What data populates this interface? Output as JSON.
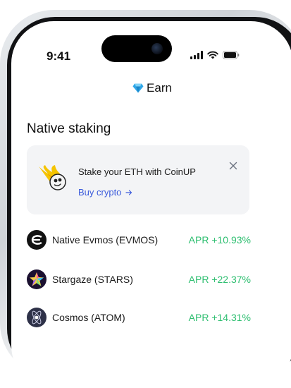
{
  "status_bar": {
    "time": "9:41"
  },
  "header": {
    "title": "Earn",
    "icon": "diamond-icon"
  },
  "section": {
    "title": "Native staking"
  },
  "promo": {
    "title": "Stake your ETH with CoinUP",
    "link_label": "Buy crypto",
    "link_icon": "arrow-right-icon",
    "close_icon": "close-icon"
  },
  "assets": [
    {
      "name": "Native Evmos (EVMOS)",
      "apr": "APR +10.93%",
      "icon": "evmos-icon"
    },
    {
      "name": "Stargaze (STARS)",
      "apr": "APR +22.37%",
      "icon": "stargaze-icon"
    },
    {
      "name": "Cosmos (ATOM)",
      "apr": "APR +14.31%",
      "icon": "cosmos-icon"
    }
  ],
  "colors": {
    "accent_link": "#3b5bdb",
    "apr_green": "#2fbf71",
    "card_bg": "#f3f4f6"
  }
}
